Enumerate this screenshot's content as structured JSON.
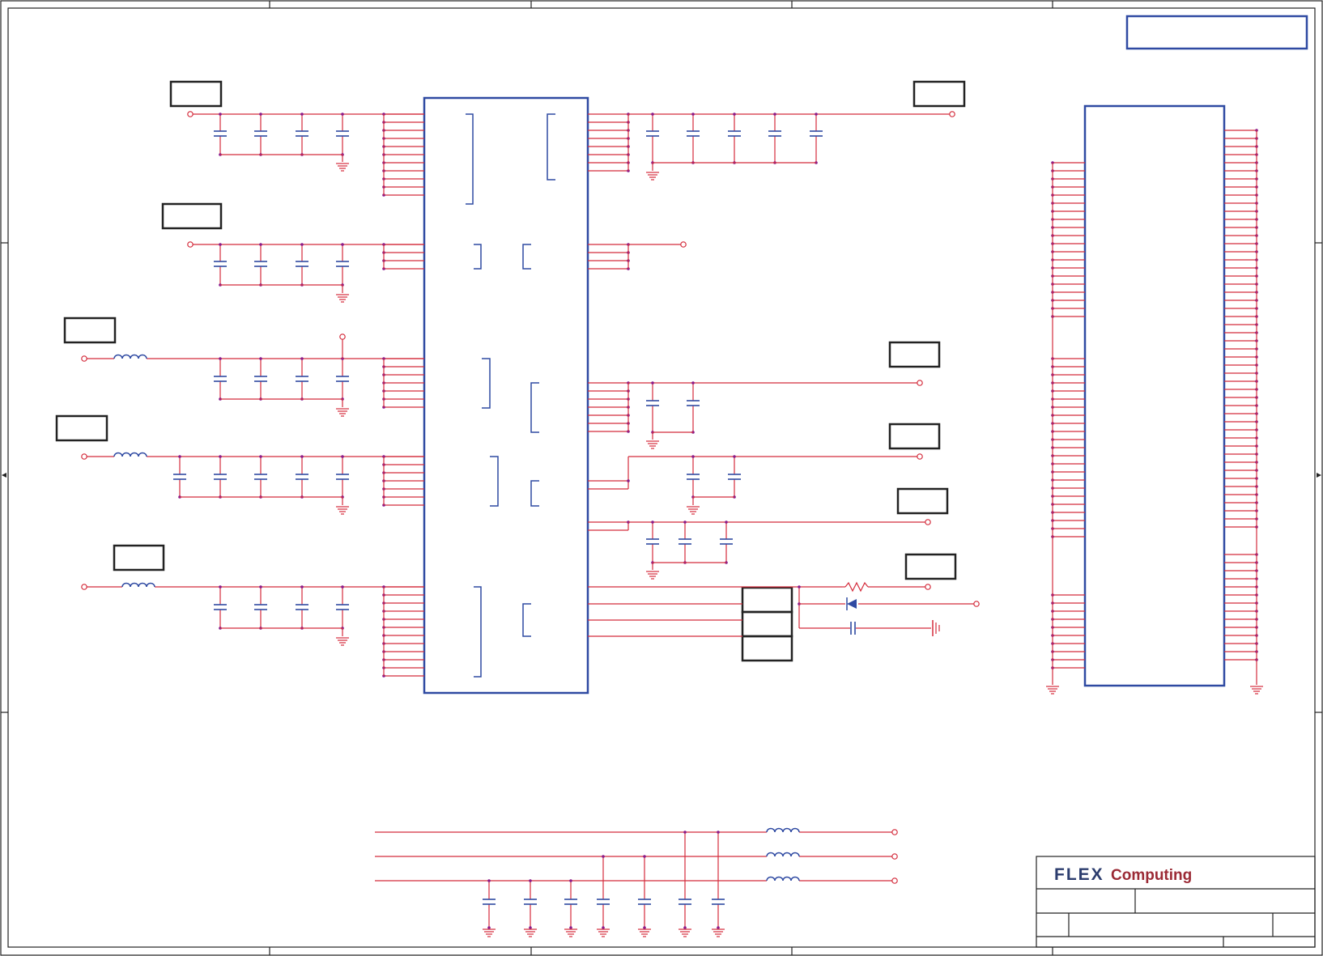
{
  "title_block": {
    "logo_part1": "FLEX",
    "logo_part2": "Computing"
  },
  "colors": {
    "frame": "#222222",
    "wire": "#d42c3c",
    "net_dot": "#8a1a8a",
    "component": "#2f4aa2",
    "ground": "#d42c3c"
  },
  "diagram": {
    "kind": "electrical-schematic",
    "parts": [
      "main-ic",
      "connector",
      "decoupling-capacitors",
      "ferrite-inductors",
      "resistor",
      "diode",
      "ground-symbols",
      "power-net-labels",
      "title-block"
    ]
  }
}
